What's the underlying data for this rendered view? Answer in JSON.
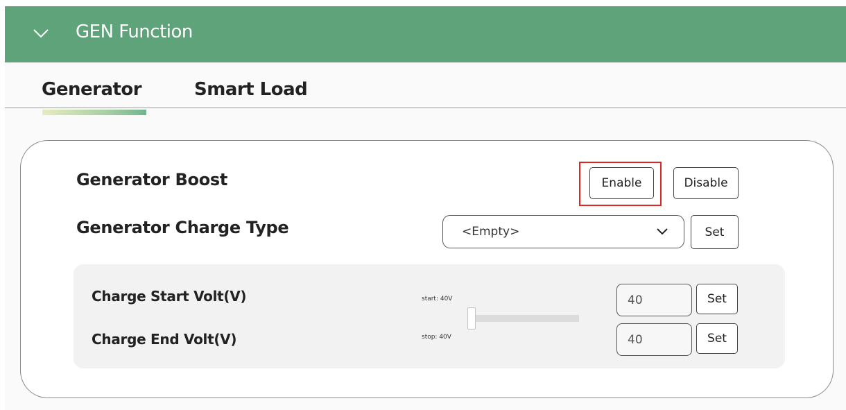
{
  "panel": {
    "title": "GEN Function",
    "expanded": true,
    "header_color": "#5fa37a"
  },
  "tabs": [
    {
      "label": "Generator",
      "active": true
    },
    {
      "label": "Smart Load",
      "active": false
    }
  ],
  "generator_boost": {
    "label": "Generator Boost",
    "enable_label": "Enable",
    "disable_label": "Disable",
    "highlighted": "Enable",
    "highlight_color": "#e02525"
  },
  "charge_type": {
    "label": "Generator Charge Type",
    "selected": "<Empty>",
    "set_label": "Set"
  },
  "charge_volt": {
    "start": {
      "label": "Charge Start Volt(V)",
      "slider_text": "start: 40V",
      "value": "40",
      "set_label": "Set"
    },
    "end": {
      "label": "Charge End Volt(V)",
      "slider_text": "stop: 40V",
      "value": "40",
      "set_label": "Set"
    }
  },
  "icons": {
    "panel_toggle": "chevron-down-icon",
    "select_arrow": "chevron-down-icon"
  }
}
